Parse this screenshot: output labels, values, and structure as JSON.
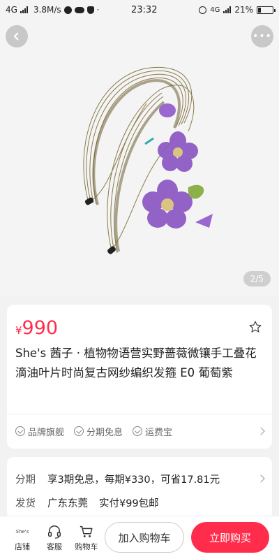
{
  "status_bar": {
    "network_left": "4G",
    "speed": "3.8M/s",
    "time": "23:32",
    "network_right": "4G",
    "battery": "21%",
    "battery_level": 0.21
  },
  "gallery": {
    "indicator": "2/5"
  },
  "product": {
    "currency": "¥",
    "price": "990",
    "title": "She's 茜子 · 植物物语营实野蔷薇微镶手工叠花滴油叶片时尚复古网纱编织发箍  E0 葡萄紫",
    "guarantees": [
      "品牌旗舰",
      "分期免息",
      "运费宝"
    ]
  },
  "info": {
    "installment_label": "分期",
    "installment_value": "享3期免息，每期¥330，可省17.81元",
    "shipping_label": "发货",
    "shipping_origin": "广东东莞",
    "shipping_cost": "实付¥99包邮"
  },
  "bottom_bar": {
    "shop_logo_text": "She's",
    "tabs": [
      {
        "label": "店铺",
        "icon": "store-icon"
      },
      {
        "label": "客服",
        "icon": "headset-icon"
      },
      {
        "label": "购物车",
        "icon": "cart-icon"
      }
    ],
    "add_to_cart": "加入购物车",
    "buy_now": "立即购买"
  },
  "colors": {
    "accent": "#ff2d4b",
    "headband_wire": "#8a7a4a",
    "flower": "#8e5bc5"
  }
}
